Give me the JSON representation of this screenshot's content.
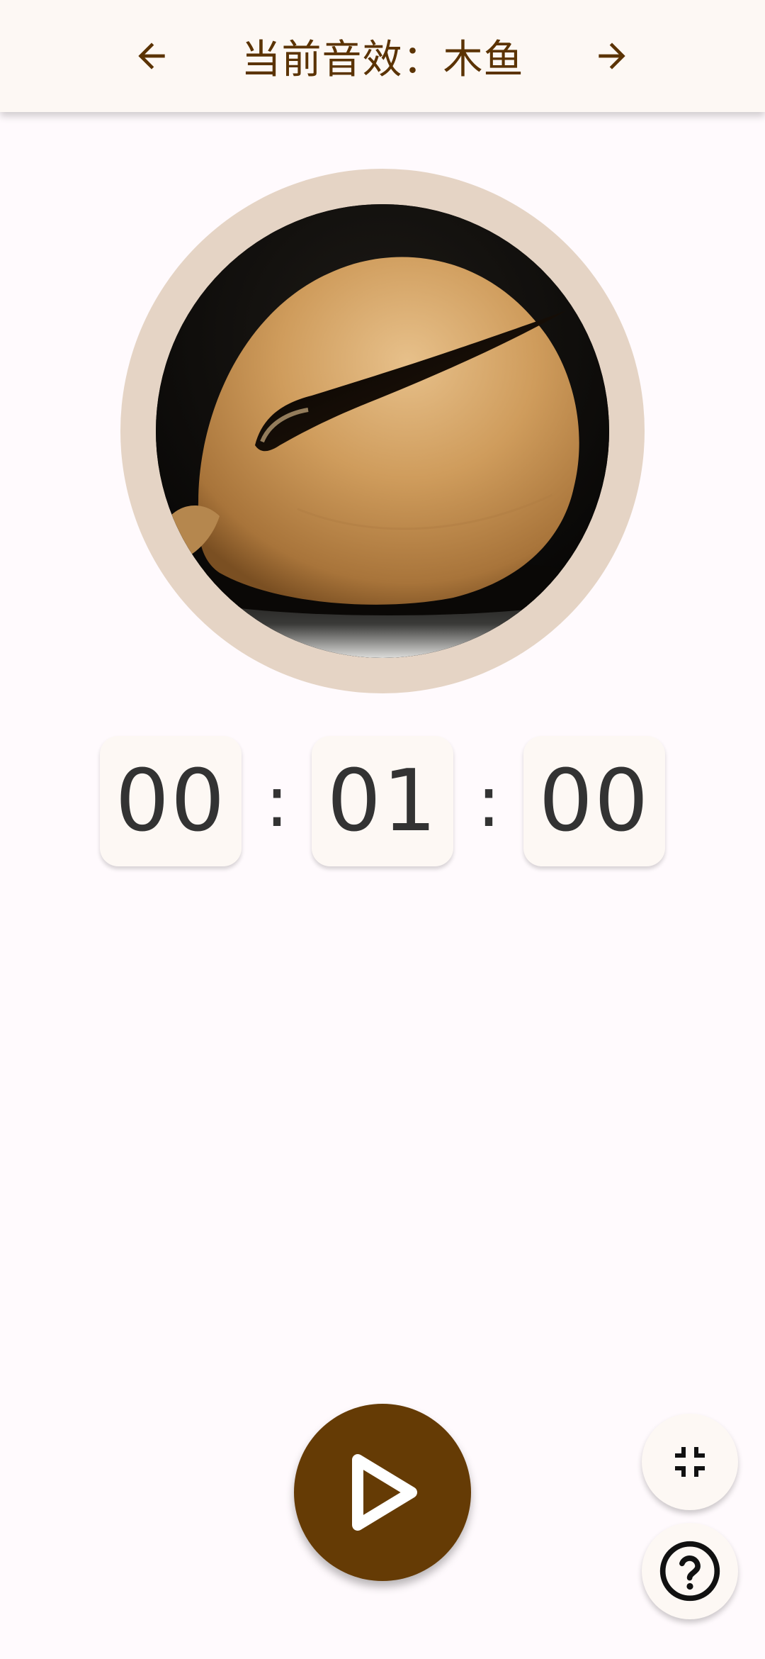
{
  "header": {
    "title": "当前音效：木鱼",
    "prev_icon": "arrow-left-icon",
    "next_icon": "arrow-right-icon"
  },
  "artwork": {
    "subject": "wooden fish (木鱼) photo"
  },
  "timer": {
    "hours": "00",
    "minutes": "01",
    "seconds": "00",
    "separator": ":"
  },
  "controls": {
    "play_icon": "play-icon",
    "fullscreen_icon": "exit-fullscreen-icon",
    "help_icon": "help-circle-icon"
  },
  "colors": {
    "accent": "#653b05",
    "title": "#5b3303",
    "surface": "#fdf8f4",
    "background": "#fffafd",
    "ring": "#e5d4c5"
  }
}
